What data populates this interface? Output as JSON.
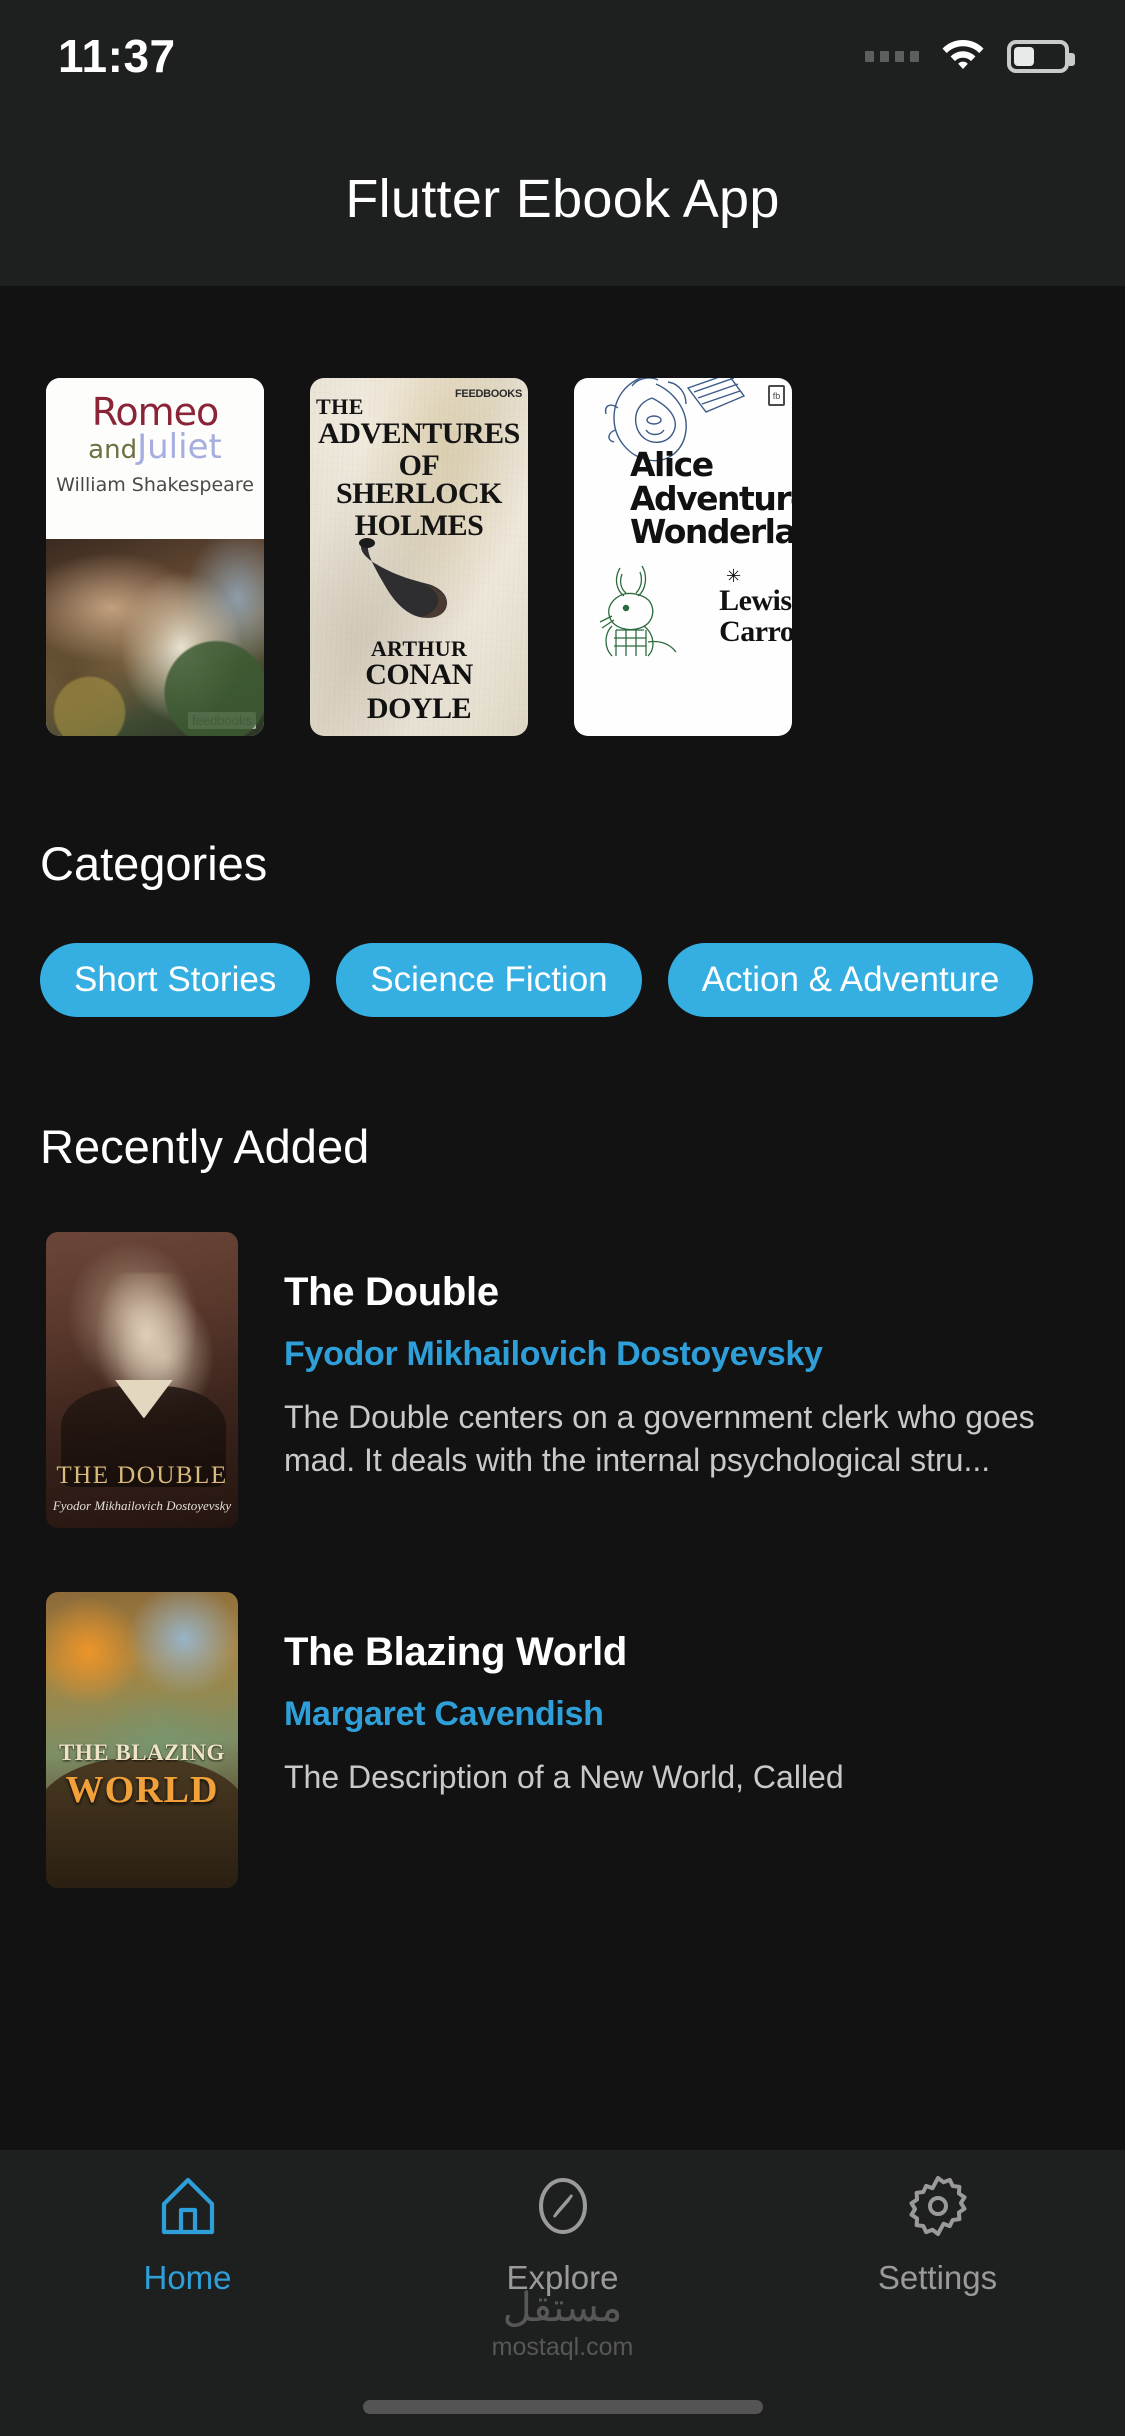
{
  "status_bar": {
    "time": "11:37",
    "signal_icon": "signal-dots-icon",
    "wifi_icon": "wifi-icon",
    "battery_icon": "battery-icon",
    "battery_level_pct": 42
  },
  "app_bar": {
    "title": "Flutter Ebook App"
  },
  "theme": {
    "background": "#121212",
    "surface": "#1e1f1f",
    "accent": "#2e9fd8",
    "chip_background": "#35aee2",
    "text_primary": "#ffffff",
    "text_secondary": "#c9c9c9",
    "nav_inactive": "#9a9a9a"
  },
  "carousel": {
    "items": [
      {
        "id": "romeo-and-juliet",
        "title_line1": "Romeo",
        "title_and": "and",
        "title_line2": "Juliet",
        "author": "William Shakespeare",
        "badge": "feedbooks"
      },
      {
        "id": "adventures-of-sherlock-holmes",
        "line1": "THE",
        "line2": "ADVENTURES OF",
        "line3": "SHERLOCK HOLMES",
        "author_line1": "ARTHUR",
        "author_line2": "CONAN DOYLE",
        "badge": "FEEDBOOKS"
      },
      {
        "id": "alices-adventures-in-wonderland",
        "title": "Alice Adventures Wonderland",
        "author_line1": "Lewis",
        "author_line2": "Carroll",
        "star": "✳",
        "badge": "fb"
      }
    ]
  },
  "categories": {
    "heading": "Categories",
    "chips": [
      {
        "label": "Short Stories"
      },
      {
        "label": "Science Fiction"
      },
      {
        "label": "Action & Adventure"
      }
    ]
  },
  "recently_added": {
    "heading": "Recently Added",
    "books": [
      {
        "title": "The Double",
        "author": "Fyodor Mikhailovich Dostoyevsky",
        "description": "The Double centers on a government clerk who goes mad. It deals with the internal psychological stru...",
        "cover_title": "THE DOUBLE",
        "cover_author": "Fyodor Mikhailovich Dostoyevsky"
      },
      {
        "title": "The Blazing World",
        "author": "Margaret Cavendish",
        "description": "The Description of a New World, Called",
        "cover_title_line1": "THE BLAZING",
        "cover_title_line2": "WORLD"
      }
    ]
  },
  "bottom_nav": {
    "items": [
      {
        "label": "Home",
        "icon": "home-icon",
        "active": true
      },
      {
        "label": "Explore",
        "icon": "compass-icon",
        "active": false
      },
      {
        "label": "Settings",
        "icon": "gear-icon",
        "active": false
      }
    ]
  },
  "watermark": {
    "arabic": "مستقل",
    "domain": "mostaql.com"
  }
}
